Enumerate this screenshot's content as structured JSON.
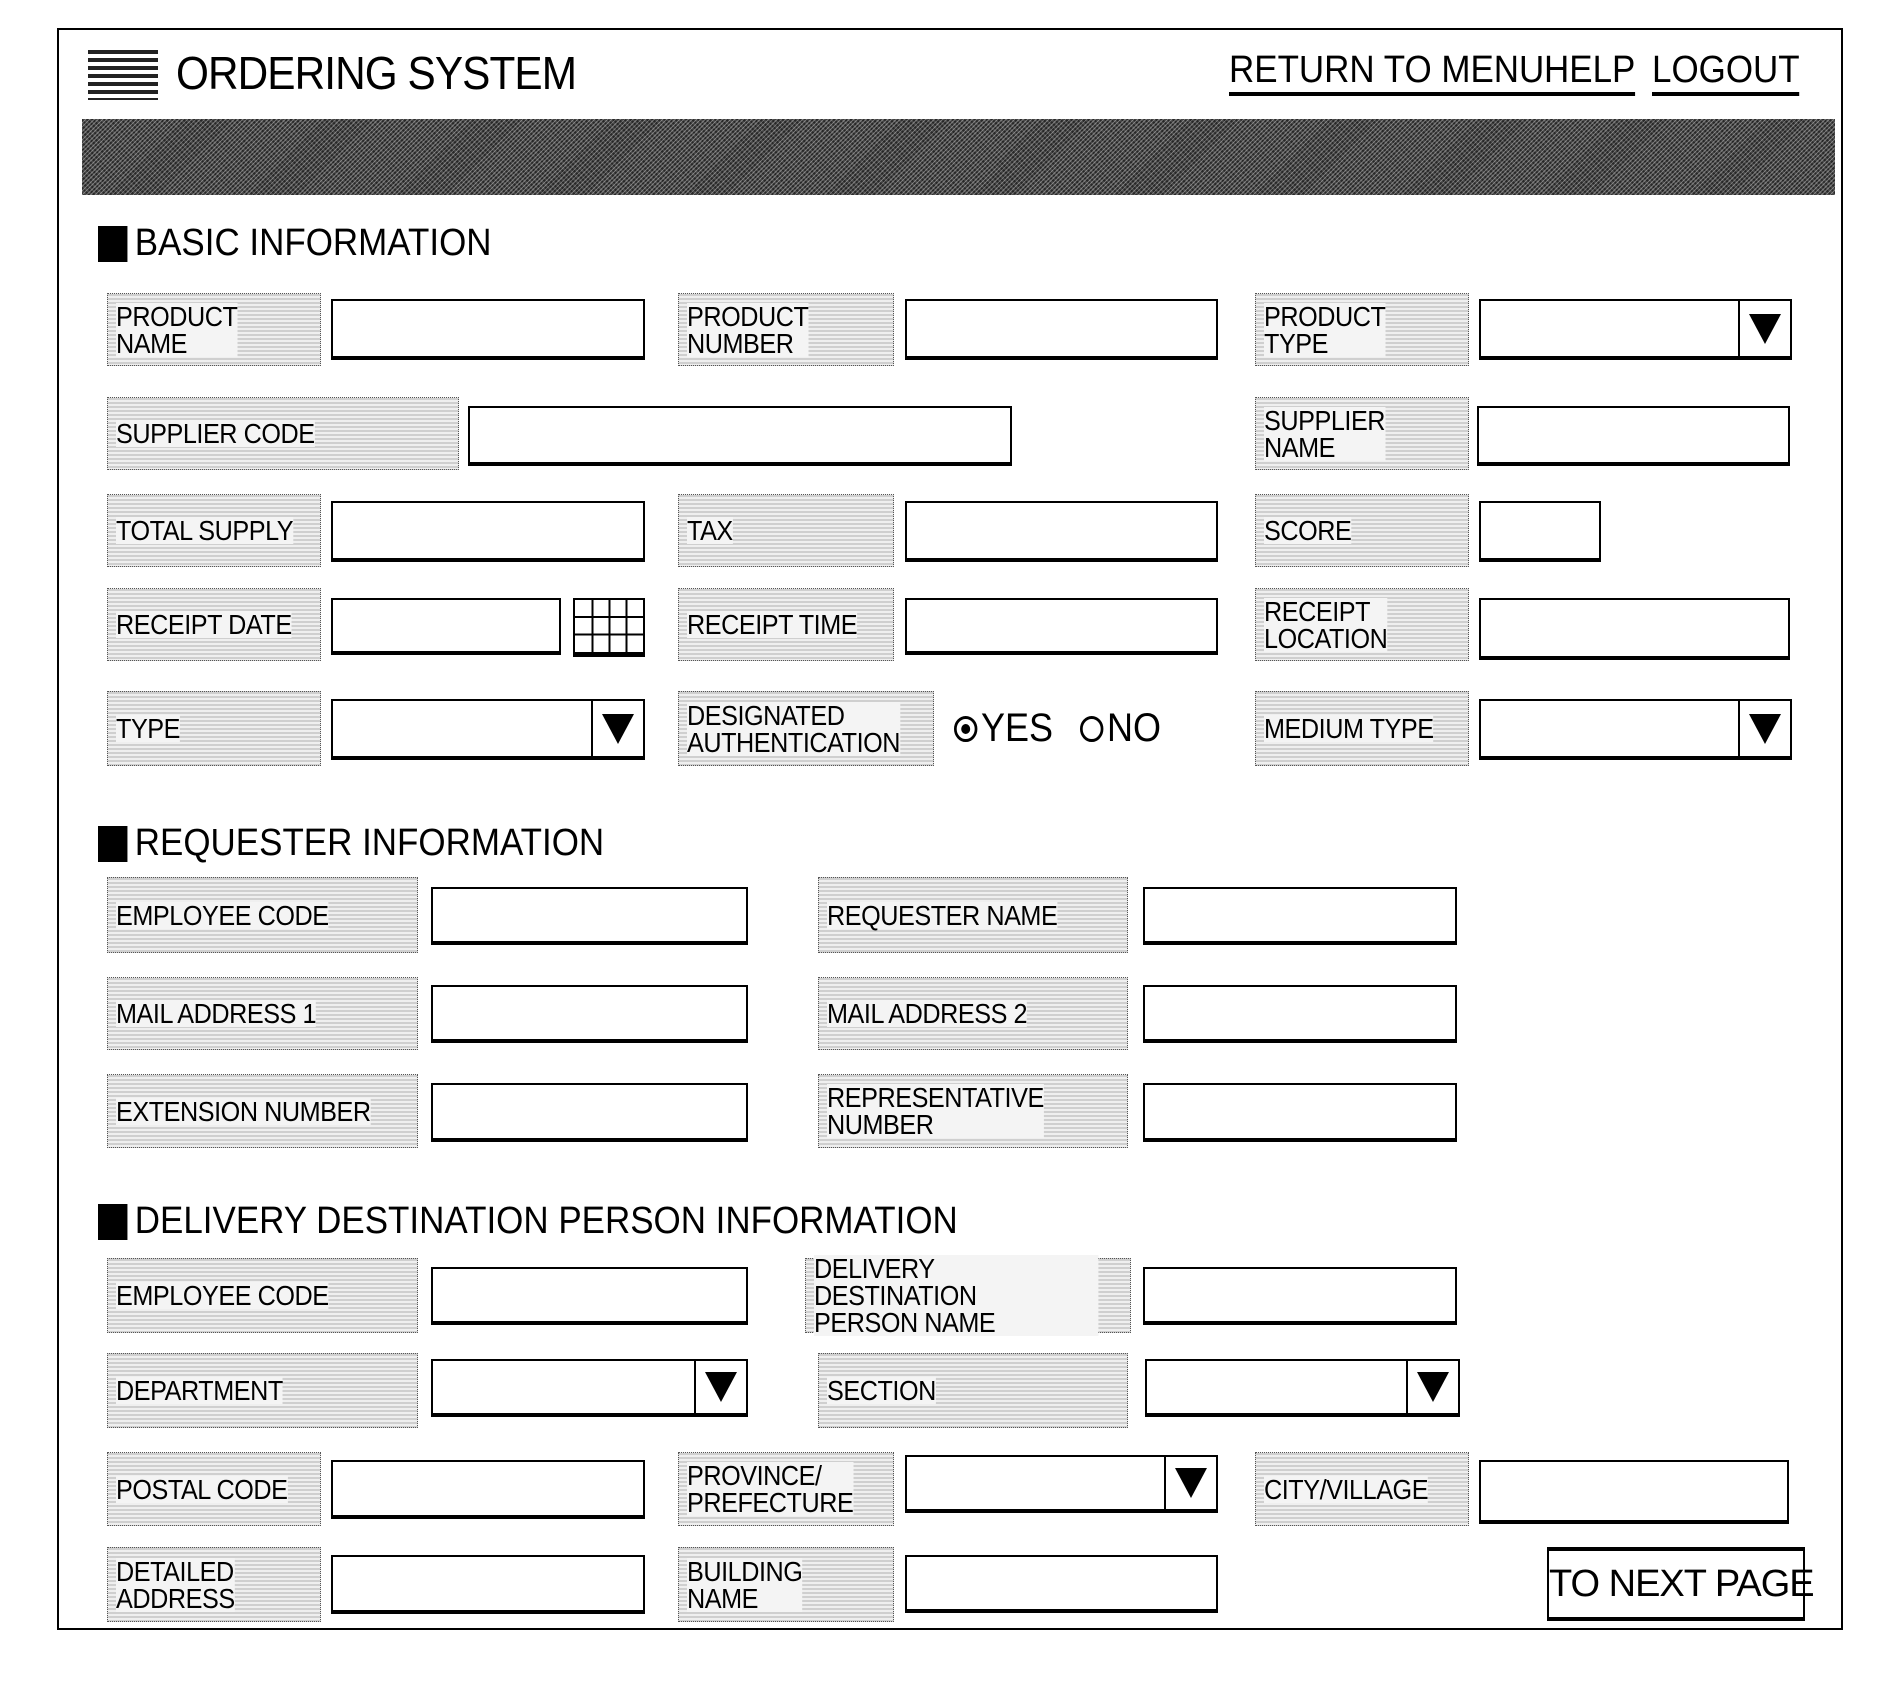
{
  "header": {
    "title": "ORDERING SYSTEM",
    "links": {
      "return_to_menu": "RETURN TO MENU",
      "help": "HELP",
      "logout": "LOGOUT"
    }
  },
  "basic": {
    "heading": "BASIC INFORMATION",
    "product_name": {
      "label": "PRODUCT\nNAME",
      "value": ""
    },
    "product_number": {
      "label": "PRODUCT\nNUMBER",
      "value": ""
    },
    "product_type": {
      "label": "PRODUCT\nTYPE",
      "value": ""
    },
    "supplier_code": {
      "label": "SUPPLIER CODE",
      "value": ""
    },
    "supplier_name": {
      "label": "SUPPLIER\nNAME",
      "value": ""
    },
    "total_supply": {
      "label": "TOTAL SUPPLY",
      "value": ""
    },
    "tax": {
      "label": "TAX",
      "value": ""
    },
    "score": {
      "label": "SCORE",
      "value": ""
    },
    "receipt_date": {
      "label": "RECEIPT DATE",
      "value": ""
    },
    "receipt_time": {
      "label": "RECEIPT TIME",
      "value": ""
    },
    "receipt_location": {
      "label": "RECEIPT\nLOCATION",
      "value": ""
    },
    "type": {
      "label": "TYPE",
      "value": ""
    },
    "designated_authentication": {
      "label": "DESIGNATED\nAUTHENTICATION",
      "options": [
        "YES",
        "NO"
      ],
      "selected": "YES"
    },
    "medium_type": {
      "label": "MEDIUM TYPE",
      "value": ""
    }
  },
  "requester": {
    "heading": "REQUESTER INFORMATION",
    "employee_code": {
      "label": "EMPLOYEE CODE",
      "value": ""
    },
    "requester_name": {
      "label": "REQUESTER NAME",
      "value": ""
    },
    "mail_address_1": {
      "label": "MAIL ADDRESS 1",
      "value": ""
    },
    "mail_address_2": {
      "label": "MAIL ADDRESS 2",
      "value": ""
    },
    "extension_number": {
      "label": "EXTENSION NUMBER",
      "value": ""
    },
    "representative_number": {
      "label": "REPRESENTATIVE\nNUMBER",
      "value": ""
    }
  },
  "delivery": {
    "heading": "DELIVERY DESTINATION PERSON INFORMATION",
    "employee_code": {
      "label": "EMPLOYEE CODE",
      "value": ""
    },
    "person_name": {
      "label": "DELIVERY DESTINATION\nPERSON NAME",
      "value": ""
    },
    "department": {
      "label": "DEPARTMENT",
      "value": ""
    },
    "section": {
      "label": "SECTION",
      "value": ""
    },
    "postal_code": {
      "label": "POSTAL CODE",
      "value": ""
    },
    "province": {
      "label": "PROVINCE/\nPREFECTURE",
      "value": ""
    },
    "city": {
      "label": "CITY/VILLAGE",
      "value": ""
    },
    "detailed_address": {
      "label": "DETAILED\nADDRESS",
      "value": ""
    },
    "building_name": {
      "label": "BUILDING\nNAME",
      "value": ""
    }
  },
  "footer": {
    "next_label": "TO NEXT PAGE"
  }
}
